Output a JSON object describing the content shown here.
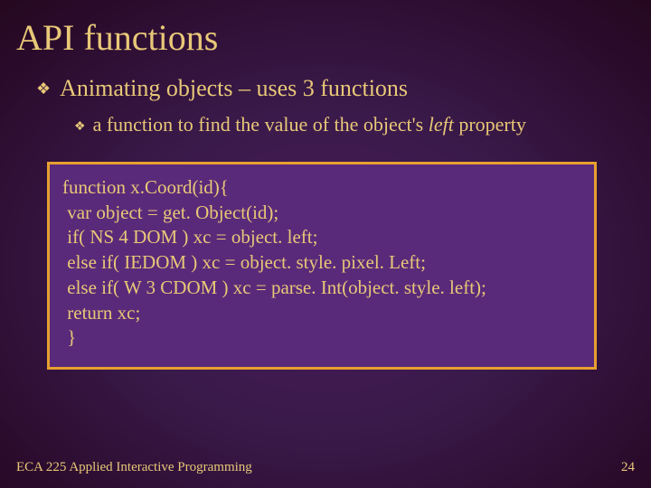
{
  "title": "API functions",
  "bullet": "Animating objects – uses 3 functions",
  "sub_prefix": "a function to find the value of the object's ",
  "sub_italic": "left",
  "sub_suffix": " property",
  "code": {
    "l1": "function x.Coord(id){",
    "l2": " var object = get. Object(id);",
    "l3": " if( NS 4 DOM ) xc = object. left;",
    "l4": " else if( IEDOM ) xc = object. style. pixel. Left;",
    "l5": " else if( W 3 CDOM ) xc = parse. Int(object. style. left);",
    "l6": " return xc;",
    "l7": " }"
  },
  "footer_left": "ECA 225   Applied Interactive Programming",
  "footer_right": "24"
}
